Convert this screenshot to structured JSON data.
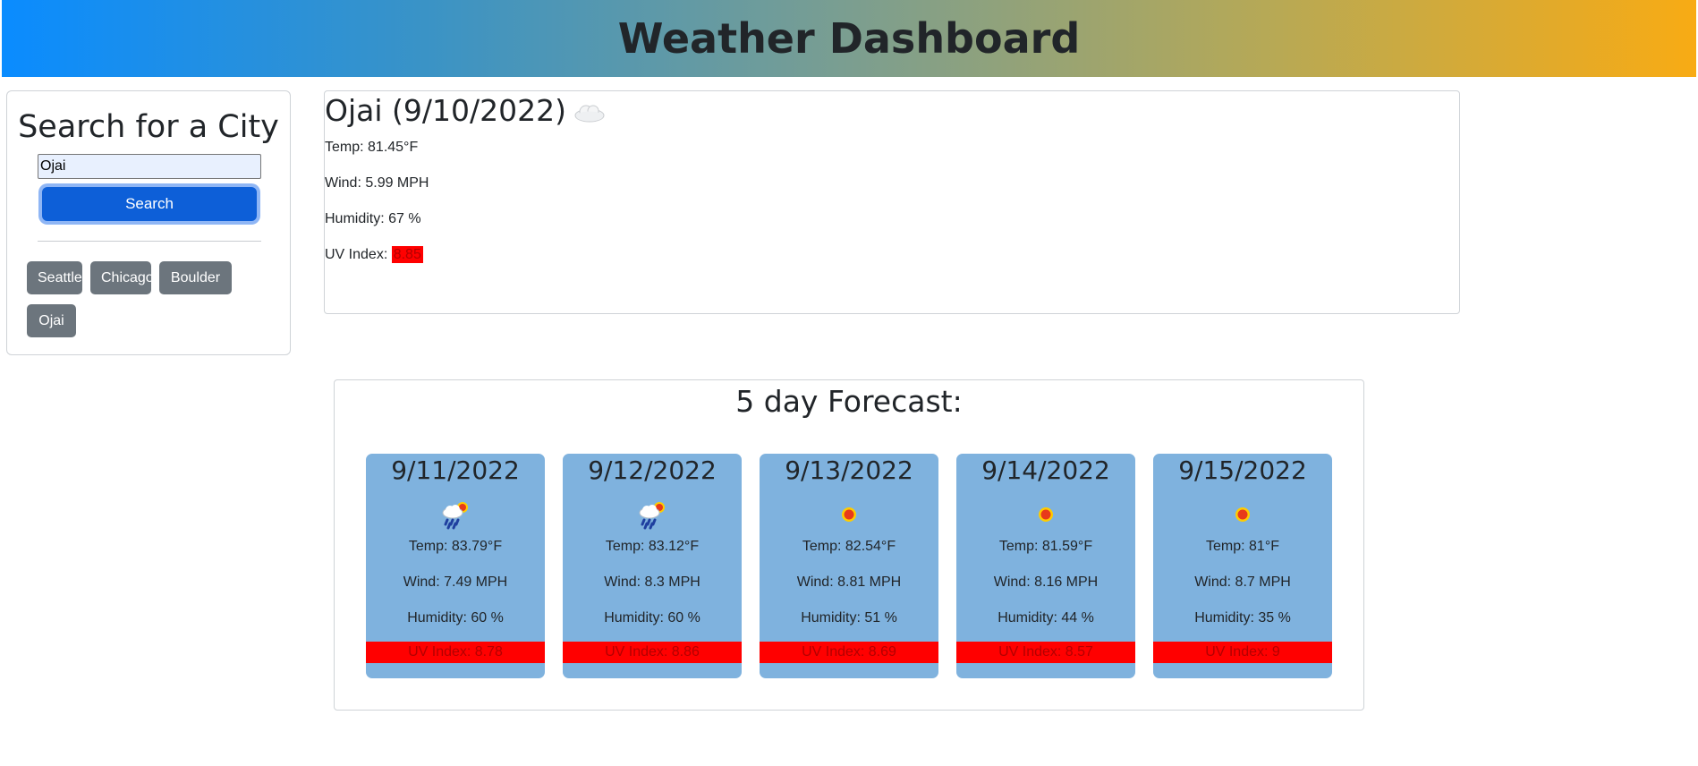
{
  "header": {
    "title": "Weather Dashboard"
  },
  "search": {
    "title": "Search for a City",
    "input_value": "Ojai",
    "button_label": "Search",
    "history": [
      "Seattle",
      "Chicago",
      "Boulder",
      "Ojai"
    ]
  },
  "current": {
    "city_date": "Ojai (9/10/2022)",
    "icon": "cloud-icon",
    "temp": "Temp: 81.45°F",
    "wind": "Wind: 5.99 MPH",
    "humidity": "Humidity: 67 %",
    "uv_label": "UV Index: ",
    "uv_value": "8.85",
    "uv_color": "#ff0000"
  },
  "forecast": {
    "title": "5 day Forecast:",
    "days": [
      {
        "date": "9/11/2022",
        "icon": "rain-sun-icon",
        "temp": "Temp: 83.79°F",
        "wind": "Wind: 7.49 MPH",
        "humidity": "Humidity: 60 %",
        "uv": "UV Index: 8.78"
      },
      {
        "date": "9/12/2022",
        "icon": "rain-sun-icon",
        "temp": "Temp: 83.12°F",
        "wind": "Wind: 8.3 MPH",
        "humidity": "Humidity: 60 %",
        "uv": "UV Index: 8.86"
      },
      {
        "date": "9/13/2022",
        "icon": "sun-icon",
        "temp": "Temp: 82.54°F",
        "wind": "Wind: 8.81 MPH",
        "humidity": "Humidity: 51 %",
        "uv": "UV Index: 8.69"
      },
      {
        "date": "9/14/2022",
        "icon": "sun-icon",
        "temp": "Temp: 81.59°F",
        "wind": "Wind: 8.16 MPH",
        "humidity": "Humidity: 44 %",
        "uv": "UV Index: 8.57"
      },
      {
        "date": "9/15/2022",
        "icon": "sun-icon",
        "temp": "Temp: 81°F",
        "wind": "Wind: 8.7 MPH",
        "humidity": "Humidity: 35 %",
        "uv": "UV Index: 9"
      }
    ]
  },
  "colors": {
    "card_bg": "#7fb2de",
    "uv_high": "#ff0000",
    "primary_button": "#0d5fd8",
    "history_button": "#6c757d"
  }
}
